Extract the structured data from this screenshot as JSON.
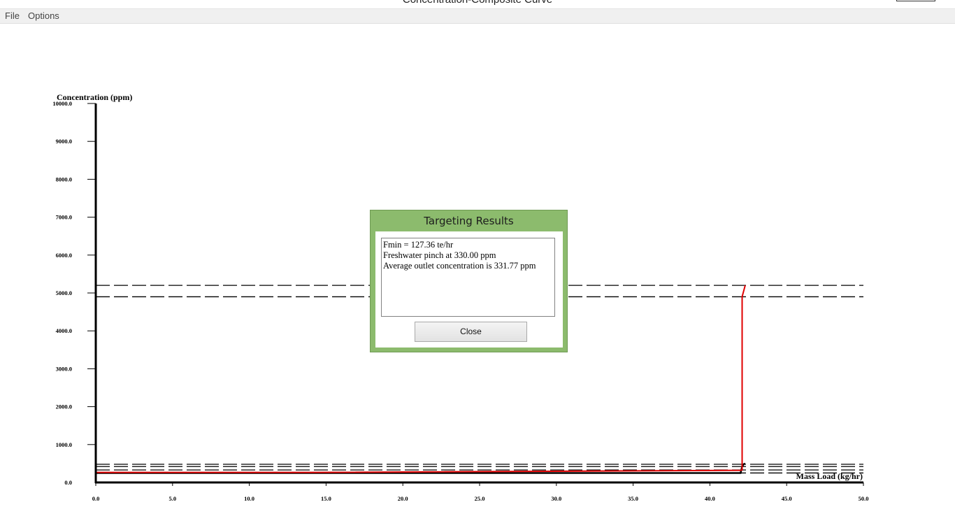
{
  "window": {
    "title": "Concentration-Composite Curve"
  },
  "menu": {
    "file": "File",
    "options": "Options"
  },
  "chart_data": {
    "type": "line",
    "xlabel": "Mass Load (kg/hr)",
    "ylabel": "Concentration (ppm)",
    "xlim": [
      0,
      50
    ],
    "ylim": [
      0,
      10000
    ],
    "x_ticks": [
      "0.0",
      "5.0",
      "10.0",
      "15.0",
      "20.0",
      "25.0",
      "30.0",
      "35.0",
      "40.0",
      "45.0",
      "50.0"
    ],
    "y_ticks": [
      "0.0",
      "1000.0",
      "2000.0",
      "3000.0",
      "4000.0",
      "5000.0",
      "6000.0",
      "7000.0",
      "8000.0",
      "9000.0",
      "10000.0"
    ],
    "grid": false,
    "dashed_levels_ppm": [
      5200,
      4900,
      480,
      420,
      330,
      250
    ],
    "limiting_composite": {
      "x": [
        0,
        14,
        42,
        42.1,
        42.2,
        42.3
      ],
      "y": [
        250,
        250,
        250,
        420,
        480,
        500
      ],
      "color": "#000000"
    },
    "water_supply_line": {
      "x": [
        0,
        14,
        42,
        42.1,
        42.1,
        42.3
      ],
      "y": [
        265,
        265,
        320,
        330,
        4900,
        5200
      ],
      "color": "#e00000"
    }
  },
  "dialog": {
    "title": "Targeting Results",
    "lines": [
      "Fmin = 127.36 te/hr",
      "Freshwater pinch at 330.00 ppm",
      "Average outlet concentration is 331.77 ppm"
    ],
    "close_label": "Close",
    "frame_color": "#8cbb6d"
  }
}
